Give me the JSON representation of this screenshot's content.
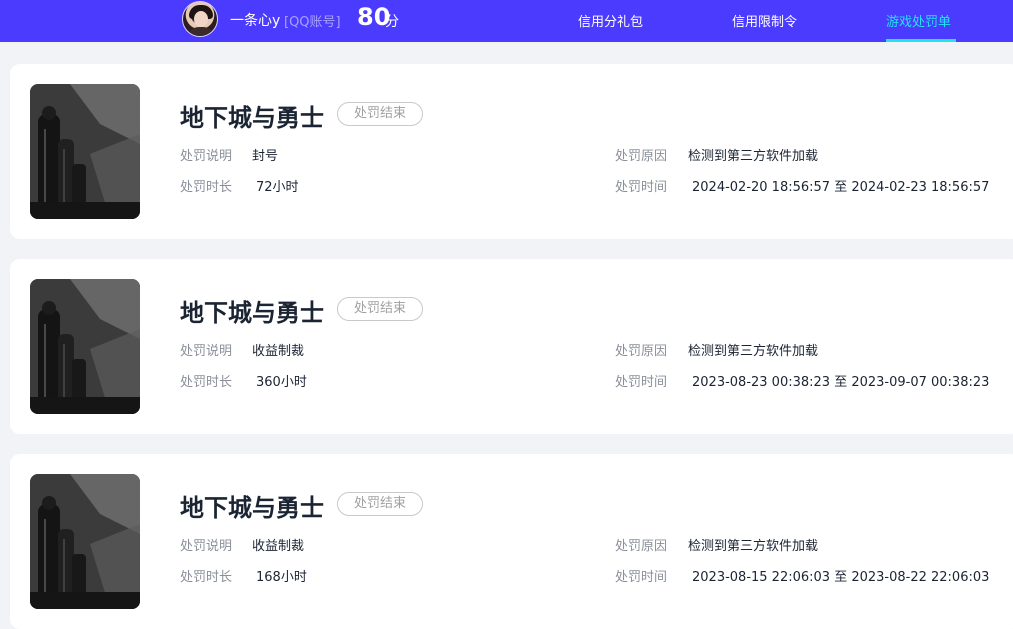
{
  "header": {
    "username": "一条心y",
    "account_type": "[QQ账号]",
    "score": "80",
    "score_unit": "分",
    "nav": [
      {
        "label": "信用分礼包"
      },
      {
        "label": "信用限制令"
      },
      {
        "label": "游戏处罚单",
        "active": true
      }
    ],
    "active_color": "#22e3f0",
    "bar_color": "#4b3bff"
  },
  "labels": {
    "desc": "处罚说明",
    "duration": "处罚时长",
    "reason": "处罚原因",
    "time": "处罚时间"
  },
  "records": [
    {
      "game": "地下城与勇士",
      "status": "处罚结束",
      "desc": "封号",
      "duration": "72小时",
      "reason": "检测到第三方软件加载",
      "time": "2024-02-20 18:56:57 至 2024-02-23 18:56:57"
    },
    {
      "game": "地下城与勇士",
      "status": "处罚结束",
      "desc": "收益制裁",
      "duration": "360小时",
      "reason": "检测到第三方软件加载",
      "time": "2023-08-23 00:38:23 至 2023-09-07 00:38:23"
    },
    {
      "game": "地下城与勇士",
      "status": "处罚结束",
      "desc": "收益制裁",
      "duration": "168小时",
      "reason": "检测到第三方软件加载",
      "time": "2023-08-15 22:06:03 至 2023-08-22 22:06:03"
    }
  ]
}
